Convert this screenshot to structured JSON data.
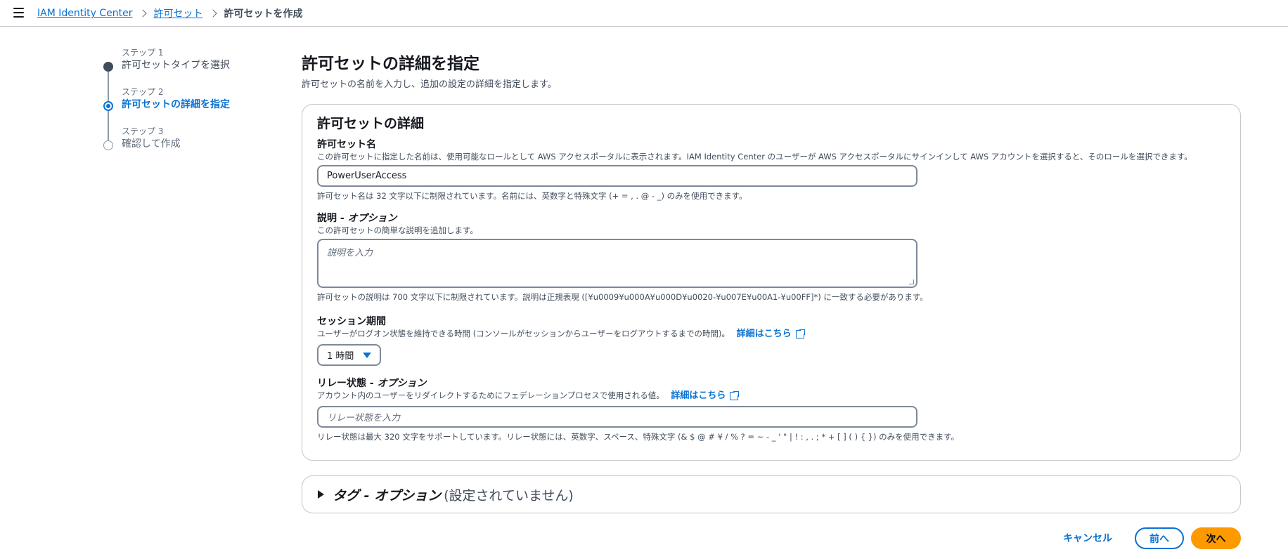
{
  "breadcrumb": {
    "items": [
      {
        "label": "IAM Identity Center"
      },
      {
        "label": "許可セット"
      }
    ],
    "current": "許可セットを作成"
  },
  "steps": [
    {
      "number": "ステップ 1",
      "label": "許可セットタイプを選択",
      "state": "done"
    },
    {
      "number": "ステップ 2",
      "label": "許可セットの詳細を指定",
      "state": "active"
    },
    {
      "number": "ステップ 3",
      "label": "確認して作成",
      "state": "pending"
    }
  ],
  "page": {
    "title": "許可セットの詳細を指定",
    "description": "許可セットの名前を入力し、追加の設定の詳細を指定します。"
  },
  "details": {
    "title": "許可セットの詳細",
    "name": {
      "label": "許可セット名",
      "description": "この許可セットに指定した名前は、使用可能なロールとして AWS アクセスポータルに表示されます。IAM Identity Center のユーザーが AWS アクセスポータルにサインインして AWS アカウントを選択すると、そのロールを選択できます。",
      "value": "PowerUserAccess",
      "hint": "許可セット名は 32 文字以下に制限されています。名前には、英数字と特殊文字 (+ = , . @ - _) のみを使用できます。"
    },
    "description_field": {
      "label_main": "説明 - ",
      "label_optional": "オプション",
      "description": "この許可セットの簡単な説明を追加します。",
      "placeholder": "説明を入力",
      "hint": "許可セットの説明は 700 文字以下に制限されています。説明は正規表現 ([¥u0009¥u000A¥u000D¥u0020-¥u007E¥u00A1-¥u00FF]*) に一致する必要があります。"
    },
    "session": {
      "label": "セッション期間",
      "description": "ユーザーがログオン状態を維持できる時間 (コンソールがセッションからユーザーをログアウトするまでの時間)。",
      "link": "詳細はこちら",
      "selected": "1 時間"
    },
    "relay": {
      "label_main": "リレー状態 - ",
      "label_optional": "オプション",
      "description": "アカウント内のユーザーをリダイレクトするためにフェデレーションプロセスで使用される値。",
      "link": "詳細はこちら",
      "placeholder": "リレー状態を入力",
      "hint": "リレー状態は最大 320 文字をサポートしています。リレー状態には、英数字、スペース、特殊文字 (& $ @ # ¥ / % ? = ~ - _ ' \" | ! : , . ; * + [ ] ( ) { }) のみを使用できます。"
    }
  },
  "tags": {
    "title": "タグ - オプション",
    "count": "(設定されていません)"
  },
  "footer": {
    "cancel": "キャンセル",
    "previous": "前へ",
    "next": "次へ"
  },
  "colors": {
    "link": "#0972d3",
    "primary_button": "#ff9900",
    "border": "#c6c6cd"
  }
}
